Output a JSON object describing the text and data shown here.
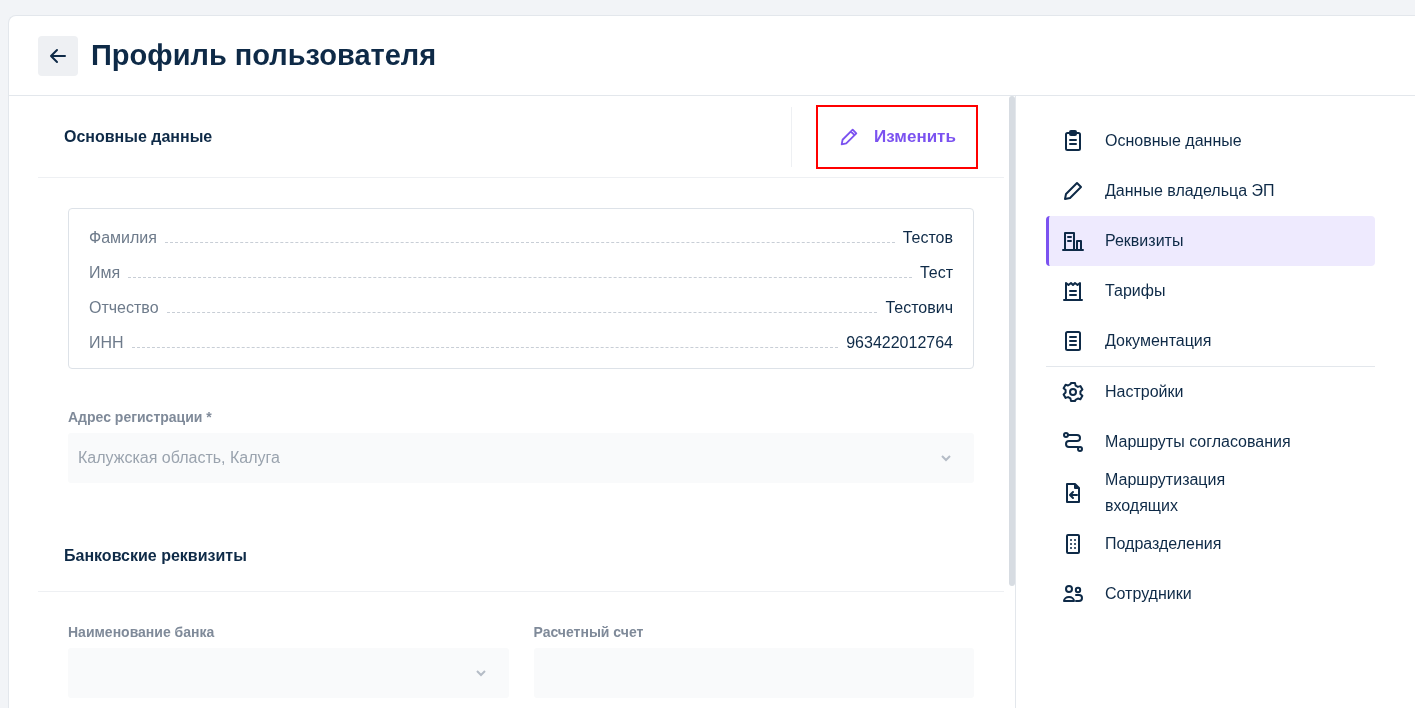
{
  "header": {
    "title": "Профиль пользователя"
  },
  "main_section": {
    "title": "Основные данные",
    "edit_button": {
      "label": "Изменить",
      "highlighted": true
    }
  },
  "details": [
    {
      "label": "Фамилия",
      "value": "Тестов"
    },
    {
      "label": "Имя",
      "value": "Тест"
    },
    {
      "label": "Отчество",
      "value": "Тестович"
    },
    {
      "label": "ИНН",
      "value": "963422012764"
    }
  ],
  "address_field": {
    "label": "Адрес регистрации *",
    "value": "Калужская область, Калуга",
    "kind": "select",
    "disabled": true
  },
  "bank_section": {
    "title": "Банковские реквизиты",
    "fields": [
      {
        "label": "Наименование банка",
        "kind": "select"
      },
      {
        "label": "Расчетный счет",
        "kind": "text"
      }
    ]
  },
  "sidebar": {
    "sections": [
      {
        "items": [
          {
            "label": "Основные данные",
            "selected": false
          },
          {
            "label": "Данные владельца ЭП",
            "selected": false
          },
          {
            "label": "Реквизиты",
            "selected": true
          },
          {
            "label": "Тарифы",
            "selected": false
          },
          {
            "label": "Документация",
            "selected": false
          }
        ]
      },
      {
        "items": [
          {
            "label": "Настройки",
            "selected": false
          },
          {
            "label": "Маршруты согласования",
            "selected": false
          },
          {
            "label": "Маршрутизация входящих",
            "selected": false
          },
          {
            "label": "Подразделения",
            "selected": false
          },
          {
            "label": "Сотрудники",
            "selected": false
          }
        ]
      }
    ]
  }
}
